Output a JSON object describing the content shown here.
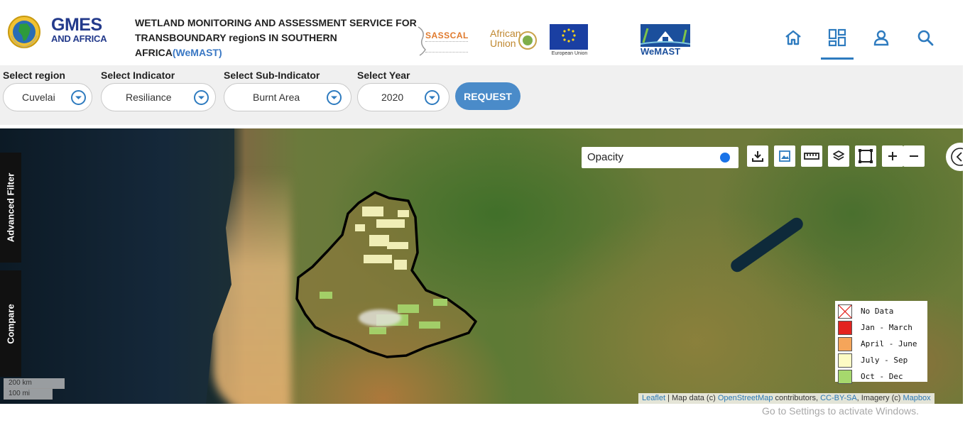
{
  "header": {
    "logo_big": "GMES",
    "logo_small": "AND AFRICA",
    "title_line1": "WETLAND MONITORING AND ASSESSMENT SERVICE FOR",
    "title_line2": "TRANSBOUNDARY regionS IN SOUTHERN AFRICA",
    "title_accent": "(WeMAST)",
    "partners": {
      "sasscal": "SASSCAL",
      "african_union_line1": "African",
      "african_union_line2": "Union",
      "eu_caption": "European Union",
      "wemast": "WeMAST"
    },
    "nav": [
      "home-icon",
      "dashboard-icon",
      "user-icon",
      "search-icon"
    ],
    "accent_color": "#2e7bbf"
  },
  "filters": {
    "region": {
      "label": "Select region",
      "value": "Cuvelai"
    },
    "indicator": {
      "label": "Select Indicator",
      "value": "Resiliance"
    },
    "sub_indicator": {
      "label": "Select Sub-Indicator",
      "value": "Burnt Area"
    },
    "year": {
      "label": "Select Year",
      "value": "2020"
    },
    "request_label": "REQUEST",
    "request_color": "#4a8bc9"
  },
  "map": {
    "side_tabs": {
      "advanced": "Advanced Filter",
      "compare": "Compare"
    },
    "opacity_label": "Opacity",
    "opacity_value": 1.0,
    "tools": [
      "download-icon",
      "image-icon",
      "ruler-icon",
      "layers-icon",
      "draw-rectangle-icon",
      "zoom-in-icon",
      "zoom-out-icon"
    ],
    "legend": [
      {
        "label": "No Data",
        "color": "#ffffff"
      },
      {
        "label": "Jan - March",
        "color": "#e3231f"
      },
      {
        "label": "April - June",
        "color": "#f5a55a"
      },
      {
        "label": "July - Sep",
        "color": "#fdfbc4"
      },
      {
        "label": "Oct - Dec",
        "color": "#a6d86d"
      }
    ],
    "scale": {
      "km": "200 km",
      "mi": "100 mi"
    },
    "attribution": {
      "leaflet": "Leaflet",
      "text1": " | Map data (c) ",
      "osm": "OpenStreetMap",
      "text2": " contributors, ",
      "license": "CC-BY-SA",
      "text3": ", Imagery (c) ",
      "mapbox": "Mapbox"
    }
  },
  "watermark": "Go to Settings to activate Windows."
}
